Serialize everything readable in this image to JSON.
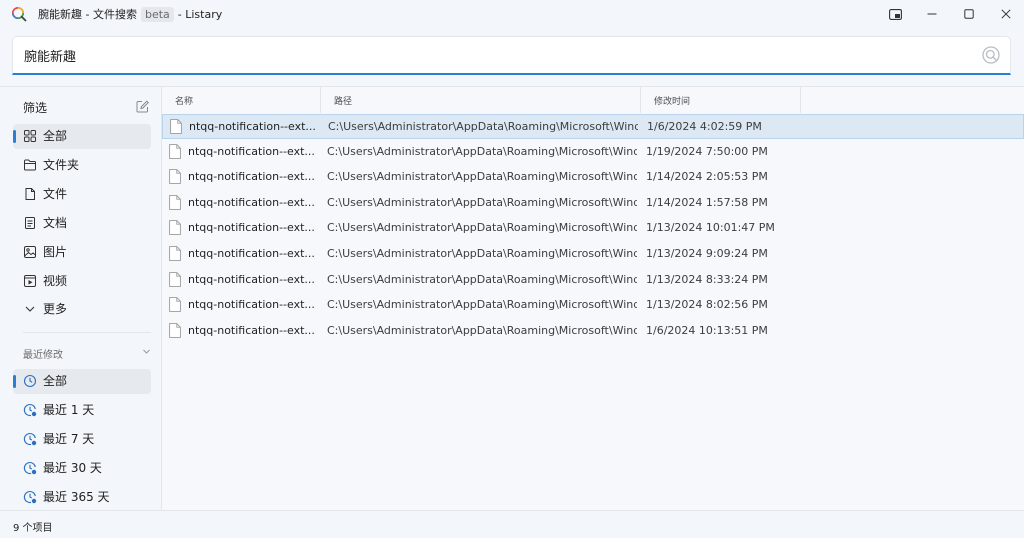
{
  "window": {
    "title_prefix": "腕能新趣 - 文件搜索",
    "title_badge": "beta",
    "title_suffix": "- Listary"
  },
  "search": {
    "value": "腕能新趣"
  },
  "sidebar": {
    "filter_heading": "筛选",
    "types": [
      {
        "label": "全部",
        "icon": "grid-icon",
        "active": true
      },
      {
        "label": "文件夹",
        "icon": "folder-icon",
        "active": false
      },
      {
        "label": "文件",
        "icon": "file-icon",
        "active": false
      },
      {
        "label": "文档",
        "icon": "document-icon",
        "active": false
      },
      {
        "label": "图片",
        "icon": "image-icon",
        "active": false
      },
      {
        "label": "视频",
        "icon": "video-icon",
        "active": false
      },
      {
        "label": "更多",
        "icon": "chevron-down-icon",
        "active": false
      }
    ],
    "recent_heading": "最近修改",
    "recent": [
      {
        "label": "全部",
        "icon": "clock-icon",
        "active": true
      },
      {
        "label": "最近 1 天",
        "icon": "clock-day-icon",
        "active": false
      },
      {
        "label": "最近 7 天",
        "icon": "clock-week-icon",
        "active": false
      },
      {
        "label": "最近 30 天",
        "icon": "clock-month-icon",
        "active": false
      },
      {
        "label": "最近 365 天",
        "icon": "clock-year-icon",
        "active": false
      }
    ]
  },
  "table": {
    "columns": [
      "名称",
      "路径",
      "修改时间"
    ],
    "rows": [
      {
        "name": "ntqq-notification--ext...",
        "path": "C:\\Users\\Administrator\\AppData\\Roaming\\Microsoft\\Windo...",
        "time": "1/6/2024 4:02:59 PM",
        "selected": true
      },
      {
        "name": "ntqq-notification--ext...",
        "path": "C:\\Users\\Administrator\\AppData\\Roaming\\Microsoft\\Windo...",
        "time": "1/19/2024 7:50:00 PM",
        "selected": false
      },
      {
        "name": "ntqq-notification--ext...",
        "path": "C:\\Users\\Administrator\\AppData\\Roaming\\Microsoft\\Windo...",
        "time": "1/14/2024 2:05:53 PM",
        "selected": false
      },
      {
        "name": "ntqq-notification--ext...",
        "path": "C:\\Users\\Administrator\\AppData\\Roaming\\Microsoft\\Windo...",
        "time": "1/14/2024 1:57:58 PM",
        "selected": false
      },
      {
        "name": "ntqq-notification--ext...",
        "path": "C:\\Users\\Administrator\\AppData\\Roaming\\Microsoft\\Windo...",
        "time": "1/13/2024 10:01:47 PM",
        "selected": false
      },
      {
        "name": "ntqq-notification--ext...",
        "path": "C:\\Users\\Administrator\\AppData\\Roaming\\Microsoft\\Windo...",
        "time": "1/13/2024 9:09:24 PM",
        "selected": false
      },
      {
        "name": "ntqq-notification--ext...",
        "path": "C:\\Users\\Administrator\\AppData\\Roaming\\Microsoft\\Windo...",
        "time": "1/13/2024 8:33:24 PM",
        "selected": false
      },
      {
        "name": "ntqq-notification--ext...",
        "path": "C:\\Users\\Administrator\\AppData\\Roaming\\Microsoft\\Windo...",
        "time": "1/13/2024 8:02:56 PM",
        "selected": false
      },
      {
        "name": "ntqq-notification--ext...",
        "path": "C:\\Users\\Administrator\\AppData\\Roaming\\Microsoft\\Windo...",
        "time": "1/6/2024 10:13:51 PM",
        "selected": false
      }
    ]
  },
  "status": {
    "count_text": "9 个项目"
  },
  "colors": {
    "accent": "#2a7fd4",
    "selected_row": "#dce9f5",
    "background": "#f3f6fa"
  }
}
